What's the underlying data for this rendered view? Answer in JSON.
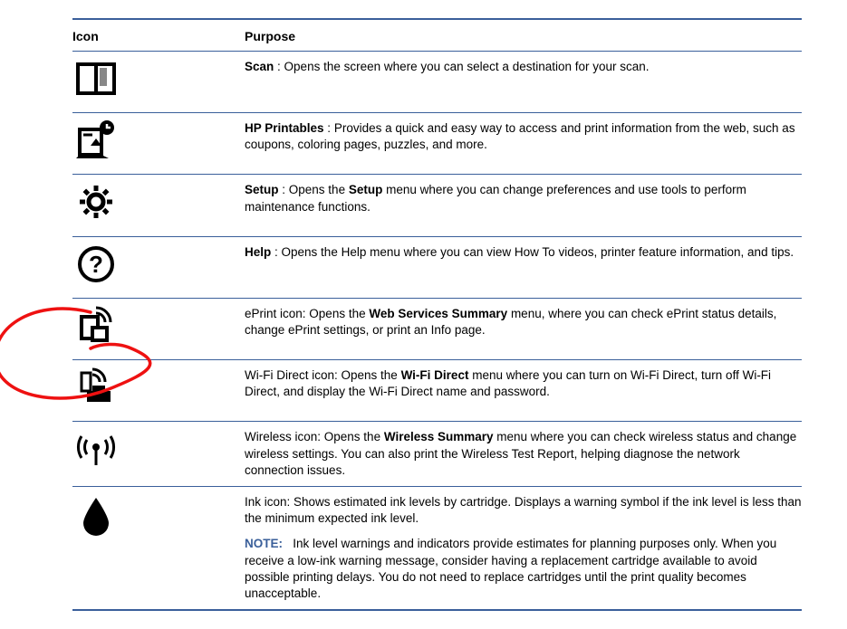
{
  "headers": {
    "icon": "Icon",
    "purpose": "Purpose"
  },
  "rows": [
    {
      "icon": "scan-icon",
      "title": "Scan",
      "sep": " : ",
      "text": "Opens the screen where you can select a destination for your scan."
    },
    {
      "icon": "printables-icon",
      "title": "HP Printables",
      "sep": " : ",
      "text": "Provides a quick and easy way to access and print information from the web, such as coupons, coloring pages, puzzles, and more."
    },
    {
      "icon": "setup-icon",
      "title": "Setup",
      "sep": " : ",
      "pre": "Opens the ",
      "emph": "Setup",
      "post": " menu where you can change preferences and use tools to perform maintenance functions."
    },
    {
      "icon": "help-icon",
      "title": "Help",
      "sep": " : ",
      "text": "Opens the Help menu where you can view How To videos, printer feature information, and tips."
    },
    {
      "icon": "eprint-icon",
      "label": "ePrint icon: ",
      "pre": "Opens the ",
      "emph": "Web Services Summary",
      "post": " menu, where you can check ePrint status details, change ePrint settings, or print an Info page."
    },
    {
      "icon": "wifi-direct-icon",
      "label": "Wi-Fi Direct icon: ",
      "pre": "Opens the ",
      "emph": "Wi-Fi Direct",
      "post": " menu where you can turn on Wi-Fi Direct, turn off Wi-Fi Direct, and display the Wi-Fi Direct name and password."
    },
    {
      "icon": "wireless-icon",
      "label": "Wireless icon: ",
      "pre": "Opens the ",
      "emph": "Wireless Summary",
      "post": " menu where you can check wireless status and change wireless settings. You can also print the Wireless Test Report, helping diagnose the network connection issues."
    },
    {
      "icon": "ink-icon",
      "label": "Ink icon: ",
      "text": "Shows estimated ink levels by cartridge. Displays a warning symbol if the ink level is less than the minimum expected ink level.",
      "note_label": "NOTE:",
      "note": "Ink level warnings and indicators provide estimates for planning purposes only. When you receive a low-ink warning message, consider having a replacement cartridge available to avoid possible printing delays. You do not need to replace cartridges until the print quality becomes unacceptable."
    }
  ]
}
